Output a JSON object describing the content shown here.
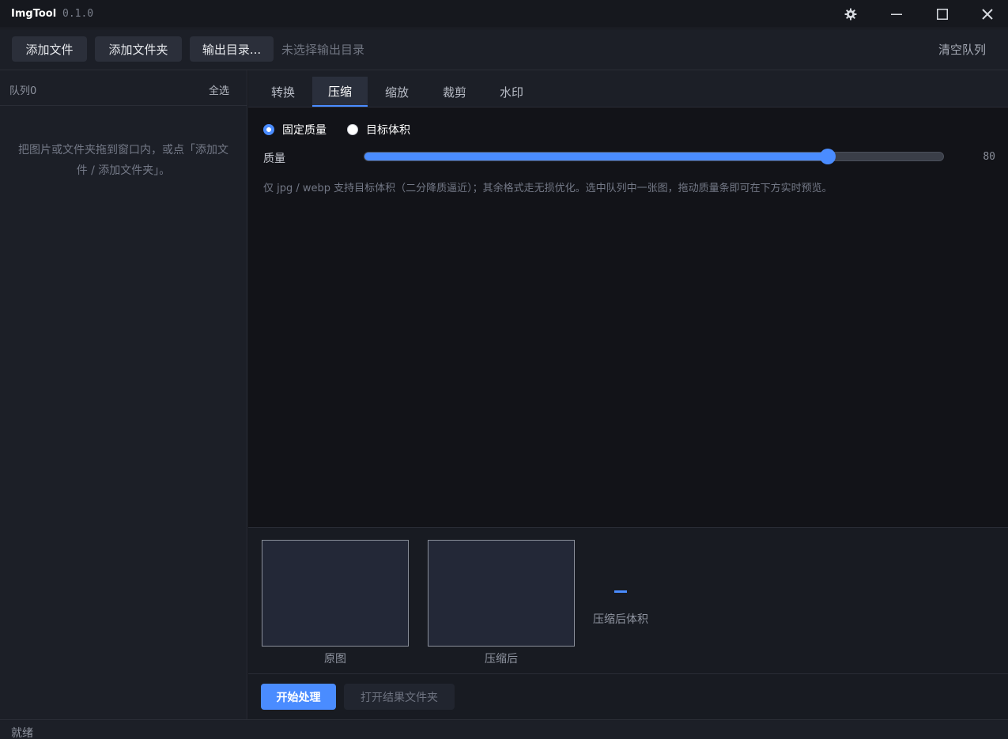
{
  "window": {
    "title": "ImgTool",
    "version": "0.1.0"
  },
  "toolbar": {
    "add_file": "添加文件",
    "add_folder": "添加文件夹",
    "output_dir_button": "输出目录...",
    "output_dir_value": "未选择输出目录",
    "clear_queue": "清空队列"
  },
  "sidebar": {
    "queue_label": "队列0",
    "select_all": "全选",
    "empty_hint": "把图片或文件夹拖到窗口内，或点「添加文件 / 添加文件夹」。"
  },
  "tabs": [
    {
      "label": "转换"
    },
    {
      "label": "压缩",
      "active": true
    },
    {
      "label": "缩放"
    },
    {
      "label": "裁剪"
    },
    {
      "label": "水印"
    }
  ],
  "compress": {
    "mode_fixed_quality": "固定质量",
    "mode_target_size": "目标体积",
    "selected_mode": "固定质量",
    "quality_label": "质量",
    "quality_value": "80",
    "quality_fraction": 0.8,
    "note": "仅 jpg / webp 支持目标体积（二分降质逼近）；其余格式走无损优化。选中队列中一张图，拖动质量条即可在下方实时预览。"
  },
  "preview": {
    "original_caption": "原图",
    "compressed_caption": "压缩后",
    "size_value": "–",
    "size_label": "压缩后体积"
  },
  "actions": {
    "start": "开始处理",
    "open_result": "打开结果文件夹"
  },
  "status": {
    "text": "就绪"
  },
  "icons": {
    "settings": "gear-icon",
    "minimize": "minimize-icon",
    "maximize": "maximize-icon",
    "close": "close-icon"
  },
  "colors": {
    "accent": "#4a8cff"
  }
}
